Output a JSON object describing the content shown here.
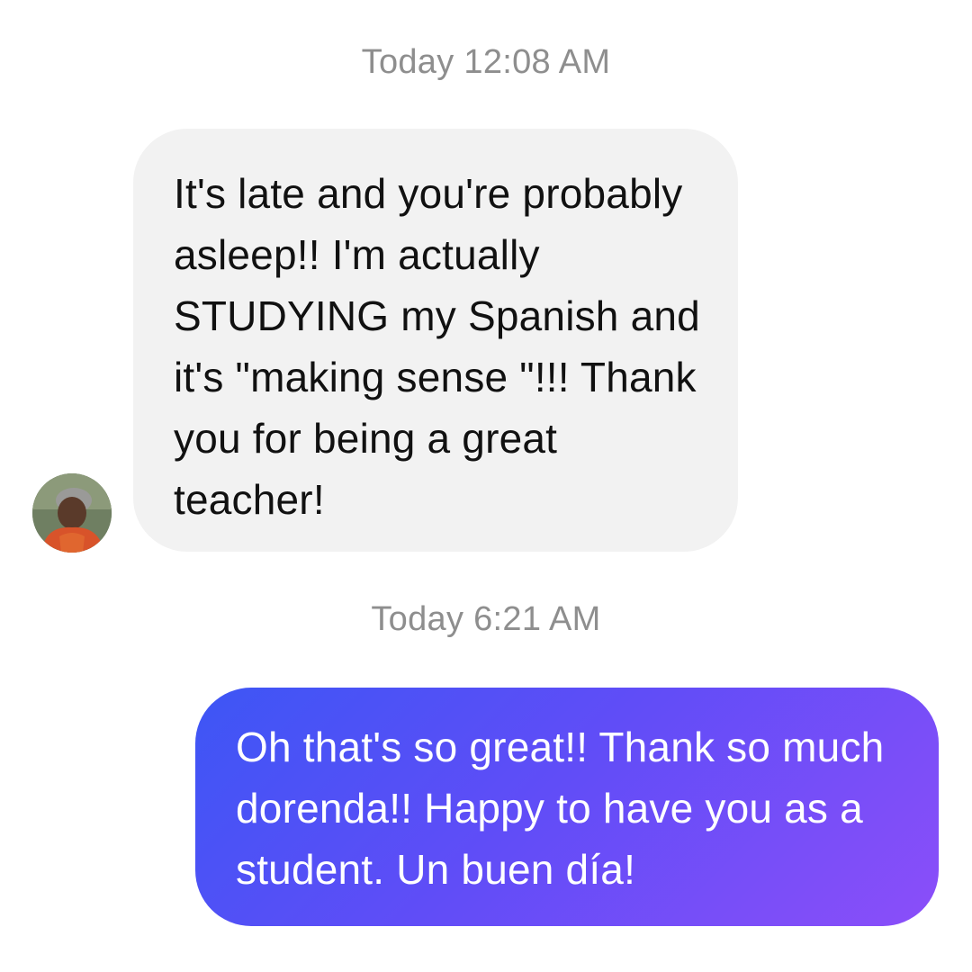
{
  "thread": {
    "timestamp_1": "Today 12:08 AM",
    "incoming_message": "It's late and you're probably asleep!! I'm actually STUDYING my Spanish and it's \"making sense \"!!! Thank you for being a great teacher!",
    "timestamp_2": "Today 6:21 AM",
    "outgoing_message": "Oh that's so great!! Thank so much dorenda!! Happy to have you as a student. Un buen día!"
  },
  "colors": {
    "incoming_bubble": "#f2f2f2",
    "outgoing_gradient_start": "#3d56f5",
    "outgoing_gradient_end": "#8b4ef9",
    "timestamp_text": "#8e8e8e"
  }
}
